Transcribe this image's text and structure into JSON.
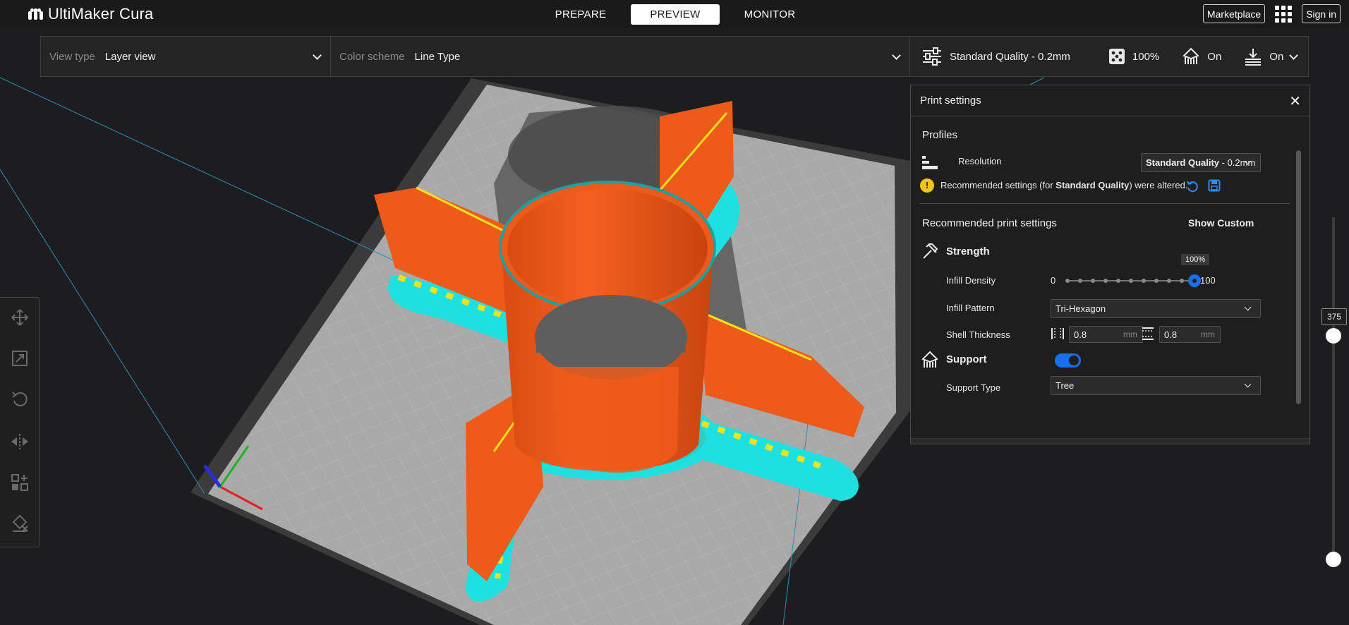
{
  "app": {
    "title": "UltiMaker Cura",
    "logo_icon": "ultimaker-logo-icon"
  },
  "stage_tabs": [
    {
      "label": "PREPARE",
      "active": false
    },
    {
      "label": "PREVIEW",
      "active": true
    },
    {
      "label": "MONITOR",
      "active": false
    }
  ],
  "topbar_right": {
    "marketplace_label": "Marketplace",
    "apps_icon": "apps-grid-icon",
    "signin_label": "Sign in"
  },
  "header_bar": {
    "view_type_label": "View type",
    "view_type_value": "Layer view",
    "color_scheme_label": "Color scheme",
    "color_scheme_value": "Line Type",
    "profile": "Standard Quality - 0.2mm",
    "infill": "100%",
    "support": "On",
    "adhesion": "On"
  },
  "panel": {
    "title": "Print settings",
    "profiles_heading": "Profiles",
    "resolution_label": "Resolution",
    "resolution_bold": "Standard Quality",
    "resolution_rest": " - 0.2mm",
    "warning_pre": "Recommended settings (for ",
    "warning_bold": "Standard Quality",
    "warning_post": ") were altered.",
    "recommended_heading": "Recommended print settings",
    "show_custom": "Show Custom",
    "strength_heading": "Strength",
    "infill_density_label": "Infill Density",
    "infill_min": "0",
    "infill_max": "100",
    "infill_tooltip": "100%",
    "infill_density_value": 1.0,
    "infill_pattern_label": "Infill Pattern",
    "infill_pattern_value": "Tri-Hexagon",
    "shell_thickness_label": "Shell Thickness",
    "wall_thickness": "0.8",
    "topbottom_thickness": "0.8",
    "unit": "mm",
    "support_heading": "Support",
    "support_enabled": true,
    "support_type_label": "Support Type",
    "support_type_value": "Tree"
  },
  "layer_slider": {
    "current_layer": "375"
  },
  "tools": [
    "move-icon",
    "scale-icon",
    "rotate-icon",
    "mirror-icon",
    "per-model-settings-icon",
    "support-blocker-icon"
  ],
  "colors": {
    "accent": "#196ef0",
    "model_orange": "#ee5a1a",
    "skirt_cyan": "#1ee0e0",
    "infill_yellow": "#f2e21c",
    "bed_gray": "#a9a9a9",
    "warning_yellow": "#f3c613"
  }
}
